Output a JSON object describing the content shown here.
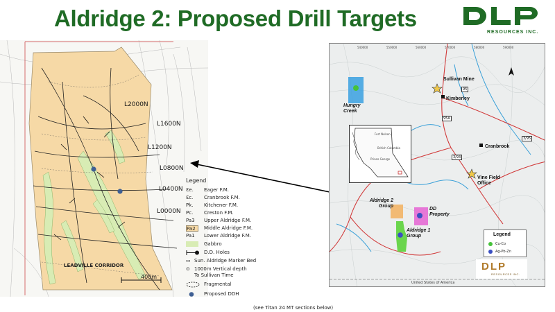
{
  "slide": {
    "title": "Aldridge 2: Proposed Drill Targets",
    "note": "(see Titan 24 MT sections below)"
  },
  "logo": {
    "mark": "DLP",
    "subtitle": "RESOURCES INC.",
    "color": "#1f6b25"
  },
  "geo_map": {
    "grid_lines": [
      "L2000N",
      "L1600N",
      "L1200N",
      "L0800N",
      "L0400N",
      "L0000N"
    ],
    "corridor_label": "LEADVILLE CORRIDOR",
    "scale_label": "400m",
    "colors": {
      "aldridge": "#f6d9a6",
      "gabbro": "#d8ecb4",
      "drill_target": "#3f5f93"
    }
  },
  "geo_legend": {
    "title": "Legend",
    "items": [
      {
        "symbol": "Ɛe.",
        "label": "Eager F.M."
      },
      {
        "symbol": "Ɛc.",
        "label": "Cranbrook F.M."
      },
      {
        "symbol": "Pk.",
        "label": "Kitchener F.M."
      },
      {
        "symbol": "Pc.",
        "label": "Creston F.M."
      },
      {
        "symbol": "Pa3",
        "label": "Upper Aldridge F.M."
      },
      {
        "symbol": "Pa2",
        "label": "Middle Aldridge F.M."
      },
      {
        "symbol": "Pa1",
        "label": "Lower Aldridge F.M."
      },
      {
        "symbol": "",
        "label": "Gabbro"
      },
      {
        "symbol": "",
        "label": "D.D. Holes"
      },
      {
        "symbol": "",
        "label": "Sun. Aldridge Marker Bed"
      },
      {
        "symbol": "",
        "label": "1000m Vertical depth To Sullivan Time"
      },
      {
        "symbol": "",
        "label": "Fragmental"
      },
      {
        "symbol": "",
        "label": "Proposed DDH"
      }
    ]
  },
  "region_map": {
    "places": {
      "sullivan_mine": "Sullivan Mine",
      "kimberley": "Kimberley",
      "cranbrook": "Cranbrook",
      "vine_field_office": "Vine Field Office",
      "hungry_creek": "Hungry Creek",
      "aldridge2_group": "Aldridge 2 Group",
      "dd_property": "DD Property",
      "aldridge1_group": "Aldridge 1 Group",
      "usa": "United States of America"
    },
    "highways": [
      "95",
      "95A",
      "3/95",
      "3/93",
      "95"
    ],
    "inset": {
      "labels": [
        "Fort Nelson",
        "British Columbia",
        "Prince George"
      ]
    },
    "legend": {
      "title": "Legend",
      "items": [
        {
          "label": "Cu-Co",
          "color": "#45c23a"
        },
        {
          "label": "Ag-Pb-Zn",
          "color": "#3a4fc2"
        }
      ]
    },
    "logo": {
      "mark": "DLP",
      "subtitle": "RESOURCES INC."
    },
    "ticks": [
      "540000",
      "550000",
      "560000",
      "570000",
      "580000",
      "590000",
      "600000"
    ]
  }
}
